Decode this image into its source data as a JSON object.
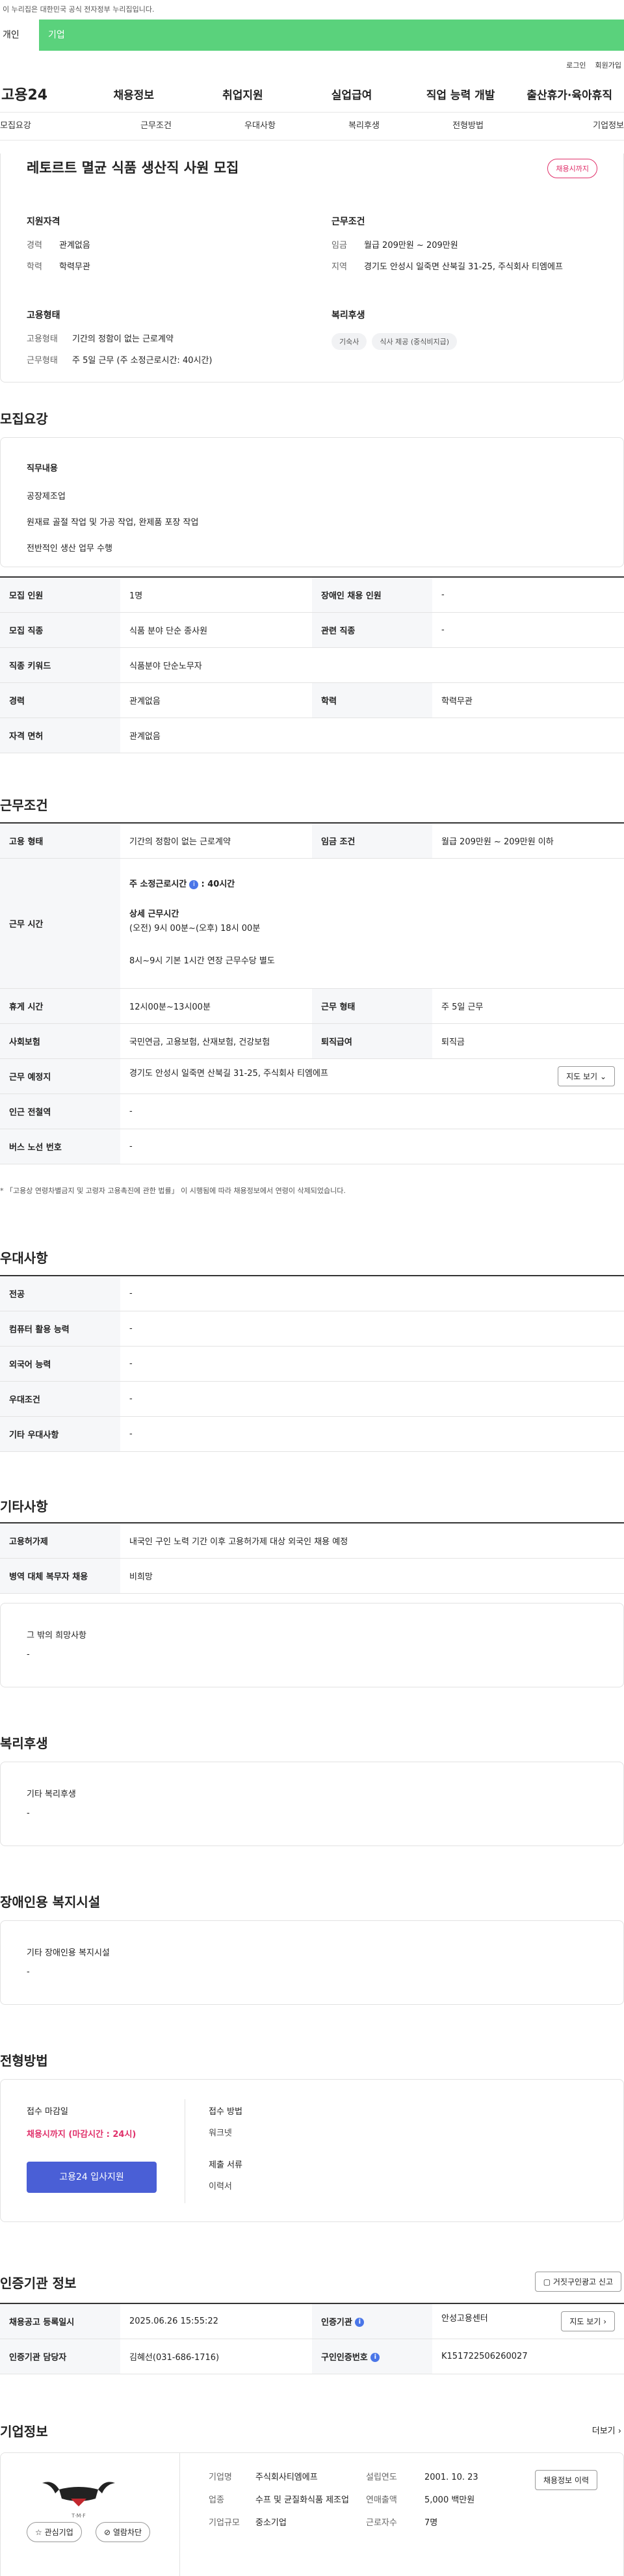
{
  "gov_banner": "이 누리집은 대한민국 공식 전자정부 누리집입니다.",
  "top_tabs": [
    "개인",
    "기업"
  ],
  "util": [
    "로그인",
    "회원가입"
  ],
  "logo": "고용24",
  "gnb": [
    "채용정보",
    "취업지원",
    "실업급여",
    "직업 능력 개발",
    "출산휴가·육아휴직"
  ],
  "lnb": [
    "모집요강",
    "근무조건",
    "우대사항",
    "복리후생",
    "전형방법",
    "기업정보"
  ],
  "summary": {
    "title": "레토르트 멸균 식품 생산직 사원 모집",
    "badge": "채용시까지",
    "qual_h": "지원자격",
    "qual": [
      {
        "k": "경력",
        "v": "관계없음"
      },
      {
        "k": "학력",
        "v": "학력무관"
      }
    ],
    "cond_h": "근무조건",
    "cond": [
      {
        "k": "임금",
        "v": "월급 209만원 ~ 209만원"
      },
      {
        "k": "지역",
        "v": "경기도 안성시 일죽면 산북길 31-25, 주식회사 티엠에프"
      }
    ],
    "emp_h": "고용형태",
    "emp": [
      {
        "k": "고용형태",
        "v": "기간의 정함이 없는 근로계약"
      },
      {
        "k": "근무형태",
        "v": "주 5일 근무 (주 소정근로시간: 40시간)"
      }
    ],
    "welfare_h": "복리후생",
    "welfare": [
      "기숙사",
      "식사 제공 (중식비지급)"
    ]
  },
  "recruit": {
    "title": "모집요강",
    "duty_h": "직무내용",
    "duty": [
      "공장제조업",
      "원재료 골절 작업 및 가공 작업, 완제품 포장 작업",
      "전반적인 생산 업무 수행"
    ],
    "rows": [
      [
        "모집 인원",
        "1명",
        "장애인 채용 인원",
        "-"
      ],
      [
        "모집 직종",
        "식품 분야 단순 종사원",
        "관련 직종",
        "-"
      ],
      [
        "직종 키워드",
        "식품분야 단순노무자"
      ],
      [
        "경력",
        "관계없음",
        "학력",
        "학력무관"
      ],
      [
        "자격 면허",
        "관계없음"
      ]
    ]
  },
  "work": {
    "title": "근무조건",
    "emp_type": [
      "고용 형태",
      "기간의 정함이 없는 근로계약",
      "임금 조건",
      "월급 209만원 ~ 209만원 이하"
    ],
    "hours_h": "근무 시간",
    "hours_week": "주 소정근로시간",
    "hours_week_v": ": 40시간",
    "detail_h": "상세 근무시간",
    "detail": "(오전) 9시 00분~(오후) 18시 00분",
    "overtime": "8시~9시 기본 1시간 연장 근무수당 별도",
    "rows": [
      [
        "휴게 시간",
        "12시00분~13시00분",
        "근무 형태",
        "주 5일 근무"
      ],
      [
        "사회보험",
        "국민연금, 고용보험, 산재보험, 건강보험",
        "퇴직급여",
        "퇴직금"
      ]
    ],
    "place_h": "근무 예정지",
    "place": "경기도 안성시 일죽면 산북길 31-25, 주식회사 티엠에프",
    "map_btn": "지도 보기",
    "subway_h": "인근 전철역",
    "subway": "-",
    "bus_h": "버스 노선 번호",
    "bus": "-",
    "note": "* 「고용상 연령차별금지 및 고령자 고용촉진에 관한 법률」 이 시행됨에 따라 채용정보에서 연령이 삭제되었습니다."
  },
  "pref": {
    "title": "우대사항",
    "rows": [
      [
        "전공",
        "-"
      ],
      [
        "컴퓨터 활용 능력",
        "-"
      ],
      [
        "외국어 능력",
        "-"
      ],
      [
        "우대조건",
        "-"
      ],
      [
        "기타 우대사항",
        "-"
      ]
    ]
  },
  "etc": {
    "title": "기타사항",
    "rows": [
      [
        "고용허가제",
        "내국인 구인 노력 기간 이후 고용허가제 대상 외국인 채용 예정"
      ],
      [
        "병역 대체 복무자 채용",
        "비희망"
      ]
    ],
    "other_h": "그 밖의 희망사항",
    "other": "-"
  },
  "welfare2": {
    "title": "복리후생",
    "h": "기타 복리후생",
    "v": "-"
  },
  "disab": {
    "title": "장애인용 복지시설",
    "h": "기타 장애인용 복지시설",
    "v": "-"
  },
  "select": {
    "title": "전형방법",
    "deadline_h": "접수 마감일",
    "deadline": "채용시까지 (마감시간 : 24시)",
    "apply_btn": "고용24 입사지원",
    "method_h": "접수 방법",
    "method": "워크넷",
    "docs_h": "제출 서류",
    "docs": "이력서"
  },
  "agency": {
    "title": "인증기관 정보",
    "report_btn": "거짓구인광고 신고",
    "rows": [
      [
        "채용공고 등록일시",
        "2025.06.26 15:55:22",
        "인증기관",
        "안성고용센터"
      ],
      [
        "인증기관 담당자",
        "김혜선(031-686-1716)",
        "구인인증번호",
        "K151722506260027"
      ]
    ],
    "map_btn": "지도 보기"
  },
  "company": {
    "title": "기업정보",
    "more": "더보기",
    "logo_text": "T·M·F",
    "fields": [
      [
        "기업명",
        "주식회사티엠에프",
        "설립연도",
        "2001. 10. 23"
      ],
      [
        "업종",
        "수프 및 균질화식품 제조업",
        "연매출액",
        "5,000 백만원"
      ],
      [
        "기업규모",
        "중소기업",
        "근로자수",
        "7명"
      ]
    ],
    "info_btn": "채용정보 이력",
    "fav": "관심기업",
    "block": "열람차단"
  }
}
